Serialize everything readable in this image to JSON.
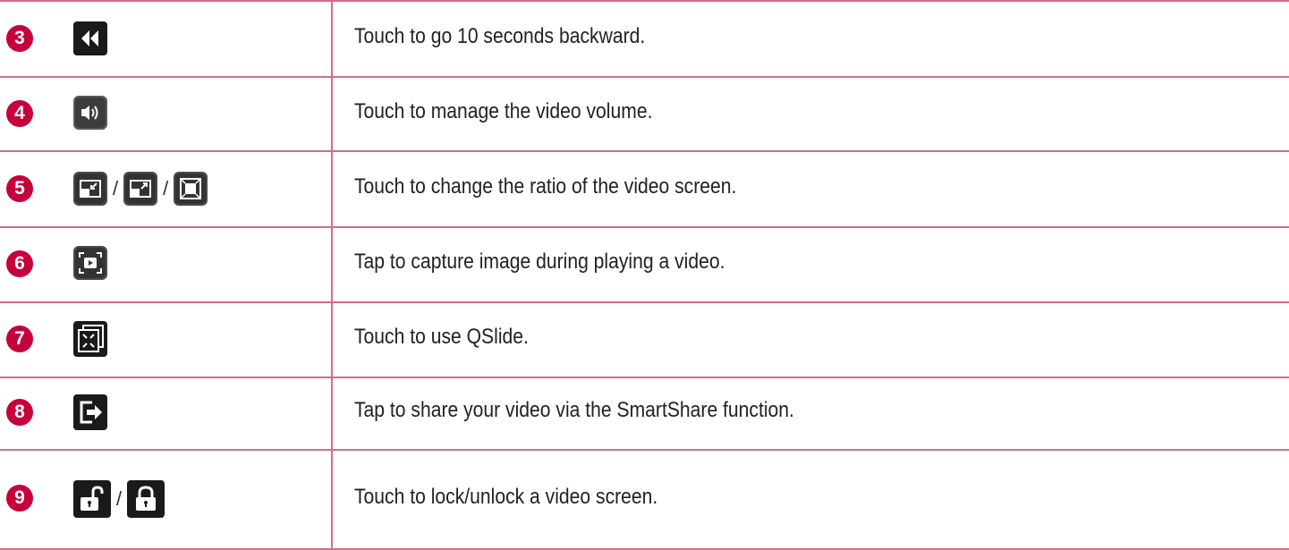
{
  "colors": {
    "accent": "#c6003d",
    "rule": "#d36d87",
    "icon_dark": "#2b2b2b"
  },
  "rows": [
    {
      "number": "3",
      "icons": [
        "rewind-10-icon"
      ],
      "separators": [],
      "description": "Touch to go 10 seconds backward."
    },
    {
      "number": "4",
      "icons": [
        "volume-icon"
      ],
      "separators": [],
      "description": "Touch to manage the video volume."
    },
    {
      "number": "5",
      "icons": [
        "ratio-shrink-icon",
        "ratio-expand-icon",
        "ratio-fit-icon"
      ],
      "separators": [
        "/",
        "/"
      ],
      "description": "Touch to change the ratio of the video screen."
    },
    {
      "number": "6",
      "icons": [
        "capture-icon"
      ],
      "separators": [],
      "description": "Tap to capture image during playing a video."
    },
    {
      "number": "7",
      "icons": [
        "qslide-icon"
      ],
      "separators": [],
      "description": "Touch to use QSlide."
    },
    {
      "number": "8",
      "icons": [
        "smartshare-icon"
      ],
      "separators": [],
      "description": "Tap to share your video via the SmartShare function."
    },
    {
      "number": "9",
      "icons": [
        "unlock-icon",
        "lock-icon"
      ],
      "separators": [
        "/"
      ],
      "description": "Touch to lock/unlock a video screen."
    }
  ]
}
